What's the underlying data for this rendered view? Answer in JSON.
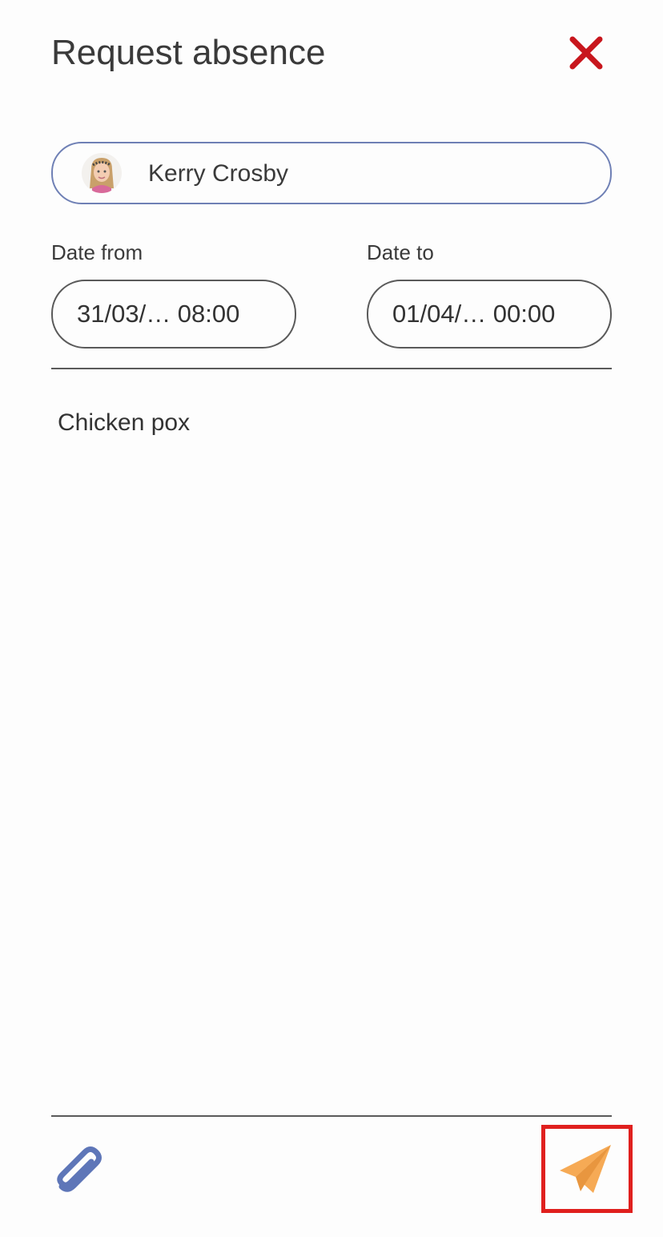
{
  "header": {
    "title": "Request absence",
    "close_icon": "close-icon",
    "close_color": "#c8161d"
  },
  "student": {
    "name": "Kerry Crosby",
    "avatar_icon": "child-avatar"
  },
  "date_from": {
    "label": "Date from",
    "value": "31/03/… 08:00"
  },
  "date_to": {
    "label": "Date to",
    "value": "01/04/… 00:00"
  },
  "reason": {
    "value": "Chicken pox"
  },
  "footer": {
    "attach_icon": "paperclip-icon",
    "attach_color": "#5e76b8",
    "send_icon": "send-icon",
    "send_color": "#f6aa55",
    "highlight_color": "#e0201e"
  }
}
